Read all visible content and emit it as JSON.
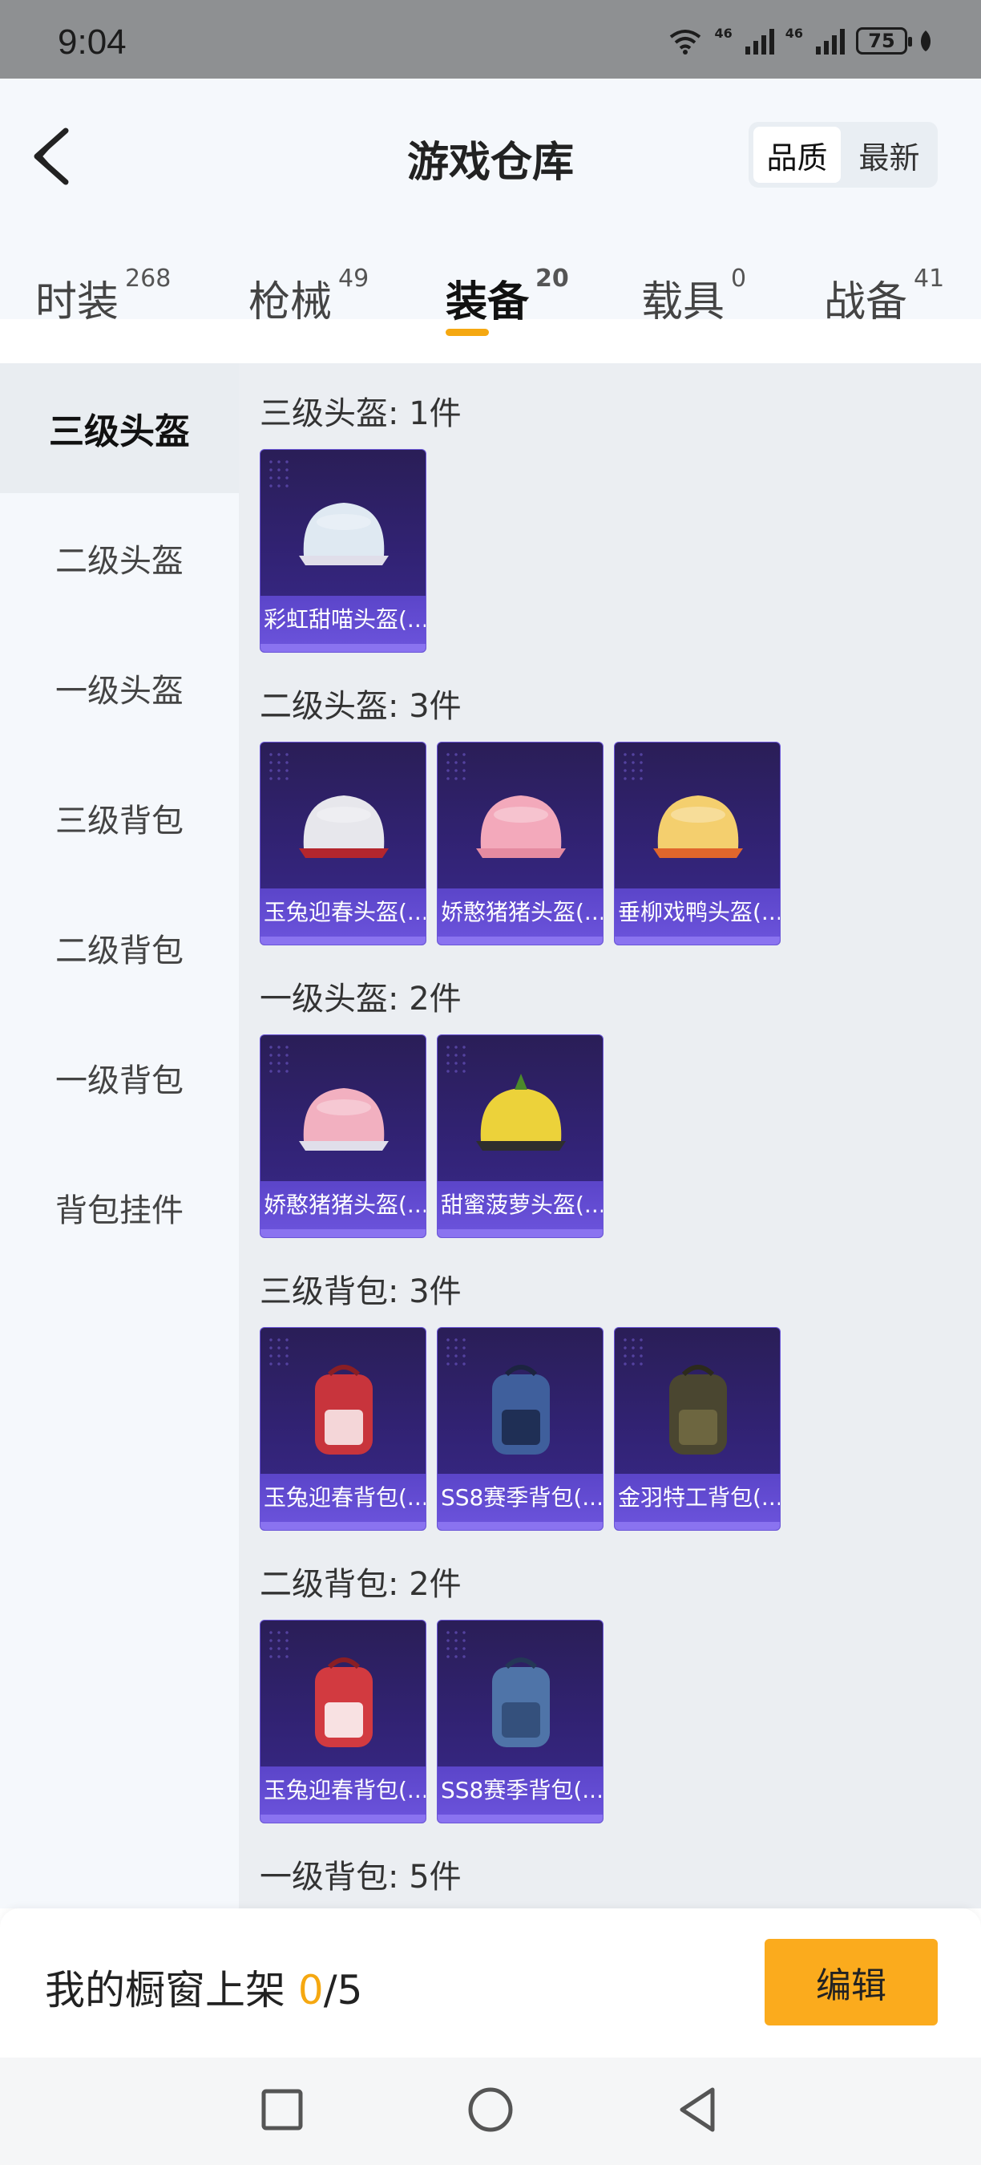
{
  "status_bar": {
    "time": "9:04",
    "net1": "46",
    "net2": "46",
    "battery": "75"
  },
  "header": {
    "title": "游戏仓库",
    "sort_options": [
      {
        "label": "品质"
      },
      {
        "label": "最新"
      }
    ]
  },
  "tabs": [
    {
      "label": "时装",
      "count": "268"
    },
    {
      "label": "枪械",
      "count": "49"
    },
    {
      "label": "装备",
      "count": "20"
    },
    {
      "label": "载具",
      "count": "0"
    },
    {
      "label": "战备",
      "count": "41"
    }
  ],
  "sidebar": {
    "items": [
      {
        "label": "三级头盔"
      },
      {
        "label": "二级头盔"
      },
      {
        "label": "一级头盔"
      },
      {
        "label": "三级背包"
      },
      {
        "label": "二级背包"
      },
      {
        "label": "一级背包"
      },
      {
        "label": "背包挂件"
      }
    ]
  },
  "sections": [
    {
      "title": "三级头盔: 1件",
      "items": [
        {
          "name": "彩虹甜喵头盔(...",
          "icon": "helmet-icon",
          "color": "#dfe9f2"
        }
      ]
    },
    {
      "title": "二级头盔: 3件",
      "items": [
        {
          "name": "玉兔迎春头盔(...",
          "icon": "helmet-icon",
          "color": "#e7e7ec"
        },
        {
          "name": "娇憨猪猪头盔(...",
          "icon": "helmet-icon",
          "color": "#f3a9bb"
        },
        {
          "name": "垂柳戏鸭头盔(...",
          "icon": "helmet-icon",
          "color": "#f4cf6e"
        }
      ]
    },
    {
      "title": "一级头盔: 2件",
      "items": [
        {
          "name": "娇憨猪猪头盔(...",
          "icon": "helmet-icon",
          "color": "#f2b0c0"
        },
        {
          "name": "甜蜜菠萝头盔(...",
          "icon": "helmet-icon",
          "color": "#ecd23a"
        }
      ]
    },
    {
      "title": "三级背包: 3件",
      "items": [
        {
          "name": "玉兔迎春背包(...",
          "icon": "backpack-icon",
          "color": "#c8343c"
        },
        {
          "name": "SS8赛季背包(...",
          "icon": "backpack-icon",
          "color": "#3f5f9c"
        },
        {
          "name": "金羽特工背包(...",
          "icon": "backpack-icon",
          "color": "#4a4630"
        }
      ]
    },
    {
      "title": "二级背包: 2件",
      "items": [
        {
          "name": "玉兔迎春背包(...",
          "icon": "backpack-icon",
          "color": "#d23a40"
        },
        {
          "name": "SS8赛季背包(...",
          "icon": "backpack-icon",
          "color": "#4f74a8"
        }
      ]
    },
    {
      "title": "一级背包: 5件",
      "items": []
    }
  ],
  "bottom_bar": {
    "label": "我的橱窗上架",
    "count": "0",
    "total": "/5",
    "edit_label": "编辑"
  },
  "colors": {
    "accent": "#f5a811",
    "card_bg": "#322376",
    "card_label_bg": "#6a52da"
  }
}
